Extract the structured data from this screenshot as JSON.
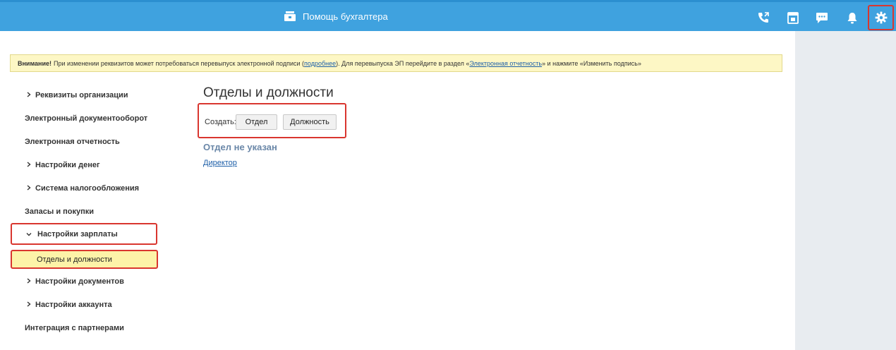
{
  "header": {
    "brand_label": "Помощь бухгалтера",
    "accent_color": "#3fa2df",
    "icons": [
      "phone-icon",
      "calendar-icon",
      "chat-icon",
      "bell-icon",
      "gear-icon"
    ]
  },
  "alert": {
    "bold": "Внимание!",
    "text1": "При изменении реквизитов может потребоваться перевыпуск электронной подписи (",
    "link1": "подробнее",
    "text2": "). Для перевыпуска ЭП перейдите в раздел «",
    "link2": "Электронная отчетность",
    "text3": "» и нажмите «Изменить подпись»"
  },
  "sidebar": {
    "items": [
      {
        "label": "Реквизиты организации"
      },
      {
        "label": "Электронный документооборот"
      },
      {
        "label": "Электронная отчетность"
      },
      {
        "label": "Настройки денег"
      },
      {
        "label": "Система налогообложения"
      },
      {
        "label": "Запасы и покупки"
      },
      {
        "label": "Настройки зарплаты"
      },
      {
        "label": "Отделы и должности"
      },
      {
        "label": "Настройки документов"
      },
      {
        "label": "Настройки аккаунта"
      },
      {
        "label": "Интеграция с партнерами"
      }
    ]
  },
  "main": {
    "title": "Отделы и должности",
    "create_label": "Создать:",
    "btn_department": "Отдел",
    "btn_position": "Должность",
    "dept_title": "Отдел не указан",
    "role_link": "Директор"
  }
}
